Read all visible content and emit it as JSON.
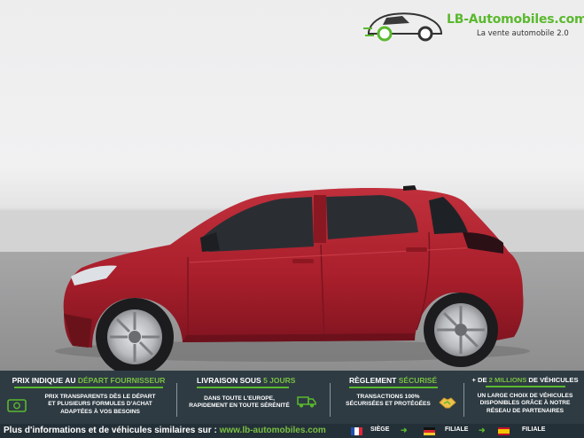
{
  "logo": {
    "brand": "LB-Automobiles.com",
    "tagline": "La vente automobile 2.0",
    "brand_color": "#5ab92e"
  },
  "photo": {
    "subject": "red-hatchback-side-view",
    "car_color": "#b3232f"
  },
  "banner": {
    "col1": {
      "title_pre": "PRIX INDIQUE AU ",
      "title_hl": "DÉPART FOURNISSEUR",
      "lines": [
        "PRIX TRANSPARENTS DÈS LE DÉPART",
        "ET PLUSIEURS FORMULES D'ACHAT",
        "ADAPTÉES À VOS BESOINS"
      ],
      "icon": "money-icon"
    },
    "col2": {
      "title_pre": "LIVRAISON SOUS ",
      "title_hl": "5 JOURS",
      "lines": [
        "DANS TOUTE L'EUROPE,",
        "RAPIDEMENT EN TOUTE SÉRÉNITÉ"
      ],
      "icon": "truck-icon"
    },
    "col3": {
      "title_pre": "RÈGLEMENT ",
      "title_hl": "SÉCURISÉ",
      "lines": [
        "TRANSACTIONS 100%",
        "SÉCURISÉES ET PROTÉGÉES"
      ],
      "icon": "handshake-icon"
    },
    "col4": {
      "title_pre": "+ DE ",
      "title_hl": "2 MILLIONS",
      "title_post": " DE VÉHICULES",
      "lines": [
        "UN LARGE CHOIX DE VÉHICULES",
        "DISPONIBLES GRÂCE À NOTRE",
        "RÉSEAU DE PARTENAIRES"
      ]
    },
    "accent": "#79c043"
  },
  "footer": {
    "text": "Plus d'informations et de véhicules similaires sur : ",
    "link": "www.lb-automobiles.com",
    "locations": [
      {
        "flag": "france-flag",
        "label": "SIÈGE"
      },
      {
        "flag": "germany-flag",
        "label": "FILIALE"
      },
      {
        "flag": "spain-flag",
        "label": "FILIALE"
      }
    ]
  }
}
